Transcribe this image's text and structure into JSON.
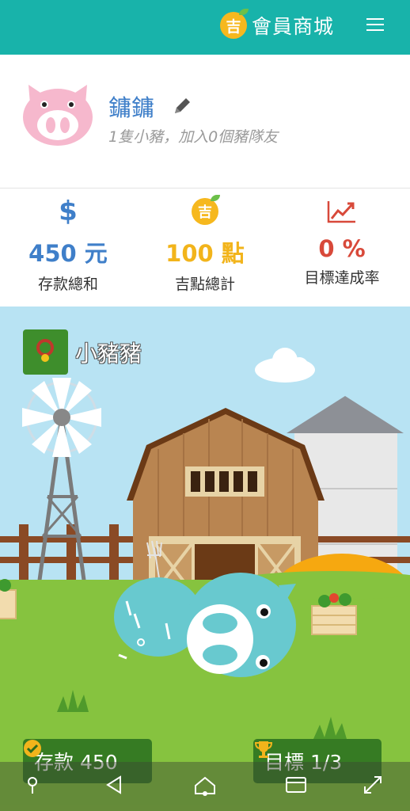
{
  "header": {
    "badge_char": "吉",
    "shop_label": "會員商城"
  },
  "profile": {
    "username": "鏞鏞",
    "subtitle": "1隻小豬，加入0個豬隊友"
  },
  "stats": [
    {
      "symbol": "$",
      "value": "450 元",
      "label": "存款總和"
    },
    {
      "symbol": "吉",
      "value": "100 點",
      "label": "吉點總計"
    },
    {
      "value": "0 %",
      "label": "目標達成率"
    }
  ],
  "pet": {
    "name": "小豬豬"
  },
  "actions": {
    "deposit_label": "存款 450",
    "goal_label": "目標 1/3"
  },
  "colors": {
    "header": "#18b3aa",
    "blue": "#3f7fc9",
    "gold": "#f2b41b",
    "red": "#d8493a",
    "pet_green": "#3e8e2c"
  }
}
